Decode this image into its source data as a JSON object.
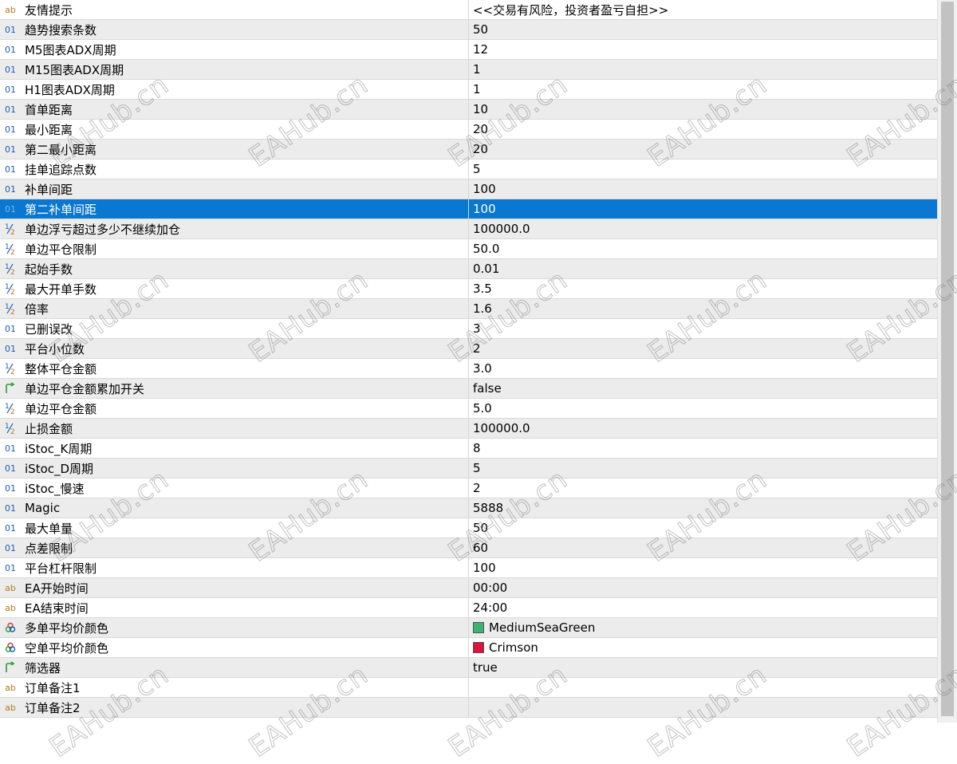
{
  "parameters": [
    {
      "type": "ab",
      "name": "友情提示",
      "value": "<<交易有风险，投资者盈亏自担>>"
    },
    {
      "type": "01",
      "name": "趋势搜索条数",
      "value": "50"
    },
    {
      "type": "01",
      "name": "M5图表ADX周期",
      "value": "12"
    },
    {
      "type": "01",
      "name": "M15图表ADX周期",
      "value": "1"
    },
    {
      "type": "01",
      "name": "H1图表ADX周期",
      "value": "1"
    },
    {
      "type": "01",
      "name": "首单距离",
      "value": "10"
    },
    {
      "type": "01",
      "name": "最小距离",
      "value": "20"
    },
    {
      "type": "01",
      "name": "第二最小距离",
      "value": "20"
    },
    {
      "type": "01",
      "name": "挂单追踪点数",
      "value": "5"
    },
    {
      "type": "01",
      "name": "补单间距",
      "value": "100"
    },
    {
      "type": "01",
      "name": "第二补单间距",
      "value": "100",
      "selected": true
    },
    {
      "type": "half",
      "name": "单边浮亏超过多少不继续加仓",
      "value": "100000.0"
    },
    {
      "type": "half",
      "name": "单边平仓限制",
      "value": "50.0"
    },
    {
      "type": "half",
      "name": "起始手数",
      "value": "0.01"
    },
    {
      "type": "half",
      "name": "最大开单手数",
      "value": "3.5"
    },
    {
      "type": "half",
      "name": "倍率",
      "value": "1.6"
    },
    {
      "type": "01",
      "name": "已删误改",
      "value": "3"
    },
    {
      "type": "01",
      "name": "平台小位数",
      "value": "2"
    },
    {
      "type": "half",
      "name": "整体平仓金额",
      "value": "3.0"
    },
    {
      "type": "bool",
      "name": "单边平仓金额累加开关",
      "value": "false"
    },
    {
      "type": "half",
      "name": "单边平仓金额",
      "value": "5.0"
    },
    {
      "type": "half",
      "name": "止损金额",
      "value": "100000.0"
    },
    {
      "type": "01",
      "name": "iStoc_K周期",
      "value": "8"
    },
    {
      "type": "01",
      "name": "iStoc_D周期",
      "value": "5"
    },
    {
      "type": "01",
      "name": "iStoc_慢速",
      "value": "2"
    },
    {
      "type": "01",
      "name": "Magic",
      "value": "5888"
    },
    {
      "type": "01",
      "name": "最大单量",
      "value": "50"
    },
    {
      "type": "01",
      "name": "点差限制",
      "value": "60"
    },
    {
      "type": "01",
      "name": "平台杠杆限制",
      "value": "100"
    },
    {
      "type": "ab",
      "name": "EA开始时间",
      "value": "00:00"
    },
    {
      "type": "ab",
      "name": "EA结束时间",
      "value": "24:00"
    },
    {
      "type": "color",
      "name": "多单平均价颜色",
      "value": "MediumSeaGreen",
      "swatch": "#3cb371"
    },
    {
      "type": "color",
      "name": "空单平均价颜色",
      "value": "Crimson",
      "swatch": "#dc143c"
    },
    {
      "type": "bool",
      "name": "筛选器",
      "value": "true"
    },
    {
      "type": "ab",
      "name": "订单备注1",
      "value": ""
    },
    {
      "type": "ab",
      "name": "订单备注2",
      "value": ""
    }
  ],
  "watermark": "EAHub.cn",
  "colors": {
    "selected_row": "#0a77d1",
    "odd_row": "#ececec",
    "icon_blue": "#1a5fb4",
    "bool_green": "#2a9d3a"
  }
}
